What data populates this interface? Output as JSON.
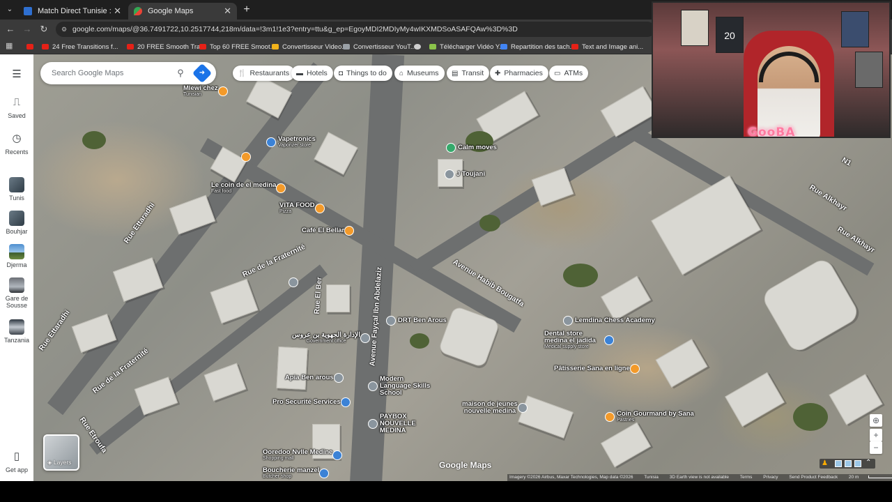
{
  "browser": {
    "tabs": [
      {
        "title": "Match Direct Tunisie : Scores et"
      },
      {
        "title": "Google Maps"
      }
    ],
    "url": "google.com/maps/@36.7491722,10.2517744,218m/data=!3m1!1e3?entry=ttu&g_ep=EgoyMDI2MDIyMy4wIKXMDSoASAFQAw%3D%3D",
    "bookmarks": [
      "24 Free Transitions f...",
      "20 FREE Smooth Tra...",
      "Top 60 FREE Smoot...",
      "Convertisseur Video...",
      "Convertisseur YouT...",
      "",
      "Télécharger Vidéo Y...",
      "Repartition des tach...",
      "Text and Image ani..."
    ]
  },
  "sidebar": {
    "items": [
      {
        "label": "Saved"
      },
      {
        "label": "Recents"
      },
      {
        "label": "Tunis"
      },
      {
        "label": "Bouhjar"
      },
      {
        "label": "Djerma"
      },
      {
        "label": "Gare de Sousse"
      },
      {
        "label": "Tanzania"
      },
      {
        "label": "Get app"
      }
    ]
  },
  "search": {
    "placeholder": "Search Google Maps"
  },
  "chips": [
    {
      "label": "Restaurants",
      "icon": "fork-knife-icon"
    },
    {
      "label": "Hotels",
      "icon": "bed-icon"
    },
    {
      "label": "Things to do",
      "icon": "camera-icon"
    },
    {
      "label": "Museums",
      "icon": "museum-icon"
    },
    {
      "label": "Transit",
      "icon": "train-icon"
    },
    {
      "label": "Pharmacies",
      "icon": "pharmacy-icon"
    },
    {
      "label": "ATMs",
      "icon": "atm-icon"
    }
  ],
  "map": {
    "roads": [
      "Rue Ettaradhi",
      "Rue de la Fraternité",
      "Avenue Habib Bougatfa",
      "Avenue Fayçal Ibn Abdelaziz",
      "Rue Alkhayr",
      "Rue Ettaradhi",
      "Rue de la Fraternité",
      "Rue Etroufa",
      "Rue El Ber",
      "N1",
      "Rue Alkhayr"
    ],
    "pois": [
      {
        "name": "Mlewi chez",
        "sub": "Tunisian",
        "kind": "food"
      },
      {
        "name": "Vapetronics",
        "sub": "Vaporizer store",
        "kind": "blue"
      },
      {
        "name": "Le coin de el medina",
        "sub": "Fast food",
        "kind": "food"
      },
      {
        "name": "VITA FOOD",
        "sub": "Pizza",
        "kind": "food"
      },
      {
        "name": "Café El Bellar",
        "sub": "",
        "kind": "food"
      },
      {
        "name": "Calm moves",
        "sub": "",
        "kind": "green"
      },
      {
        "name": "J Toujani",
        "sub": "",
        "kind": "gray"
      },
      {
        "name": "DRT Ben Arous",
        "sub": "",
        "kind": "gray"
      },
      {
        "name": "الإدارة الجهوية بن عروس",
        "sub": "Government office",
        "kind": "gray"
      },
      {
        "name": "Apia Ben arous",
        "sub": "",
        "kind": "gray"
      },
      {
        "name": "Modern Language Skills School",
        "sub": "",
        "kind": "gray"
      },
      {
        "name": "Pro Securité Services",
        "sub": "",
        "kind": "blue"
      },
      {
        "name": "PAYBOX NOUVELLE MEDINA",
        "sub": "",
        "kind": "gray"
      },
      {
        "name": "maison de jeunes nouvelle medina",
        "sub": "",
        "kind": "gray"
      },
      {
        "name": "Lemdina Chess Academy",
        "sub": "",
        "kind": "gray"
      },
      {
        "name": "Dental store medina el jadida",
        "sub": "Medical supply store",
        "kind": "blue"
      },
      {
        "name": "Pâtisserie Sana en ligne",
        "sub": "",
        "kind": "food"
      },
      {
        "name": "Coin Gourmand by Sana",
        "sub": "Pastries",
        "kind": "food"
      },
      {
        "name": "Ooredoo Nvlle Medine",
        "sub": "Shopping mall",
        "kind": "blue"
      },
      {
        "name": "Boucherie manzel",
        "sub": "Butcher shop",
        "kind": "blue"
      }
    ],
    "layers_label": "Layers",
    "logo": "Google Maps",
    "attribution": [
      "Imagery ©2026 Airbus, Maxar Technologies, Map data ©2026",
      "Tunisia",
      "3D Earth view is not available",
      "Terms",
      "Privacy",
      "Send Product Feedback",
      "20 m"
    ]
  },
  "overlay": {
    "streamer_tag": "GooBA",
    "jersey_number": "20"
  },
  "colors": {
    "accent": "#1a73e8",
    "food_pin": "#f39a2a",
    "stream_tag": "#ff7aa0"
  }
}
